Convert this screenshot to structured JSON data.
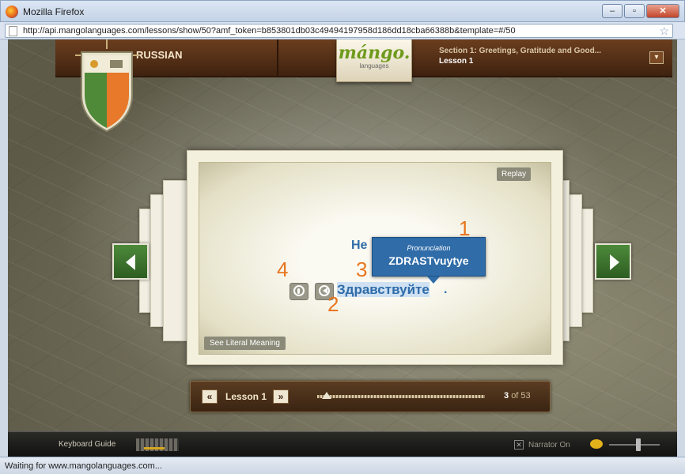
{
  "window": {
    "title": "Mozilla Firefox",
    "minimize": "–",
    "maximize": "▫",
    "close": "✕"
  },
  "address_bar": {
    "url": "http://api.mangolanguages.com/lessons/show/50?amf_token=b853801db03c49494197958d186dd18cba66388b&template=#/50"
  },
  "header": {
    "language": "RUSSIAN",
    "brand": "mángo.",
    "brand_sub": "languages",
    "section": "Section 1: Greetings, Gratitude and Good...",
    "lesson": "Lesson 1",
    "menu_icon": "▾"
  },
  "card": {
    "replay_label": "Replay",
    "literal_label": "See Literal Meaning",
    "partial_word": "He",
    "tooltip_label": "Pronunciation",
    "tooltip_value": "ZDRASTvuytye",
    "main_word": "Здравствуйте",
    "period": "."
  },
  "annotations": {
    "n1": "1",
    "n2": "2",
    "n3": "3",
    "n4": "4"
  },
  "lesson_bar": {
    "prev": "«",
    "next": "»",
    "label": "Lesson 1",
    "current": "3",
    "of_label": "of 53",
    "progress_fraction": 0.057
  },
  "footer": {
    "keyboard_guide": "Keyboard Guide",
    "narrator": "Narrator On",
    "narrator_box": "✕"
  },
  "status_bar": {
    "text": "Waiting for www.mangolanguages.com..."
  },
  "colors": {
    "accent_blue": "#2f6ca8",
    "accent_orange": "#e8751d",
    "nav_green": "#3f7a30"
  },
  "icons": [
    "firefox-logo-icon",
    "page-icon",
    "bookmark-star-icon",
    "dropdown-arrow-icon",
    "microphone-icon",
    "speaker-icon",
    "left-arrow-icon",
    "right-arrow-icon",
    "chat-bubble-icon"
  ]
}
